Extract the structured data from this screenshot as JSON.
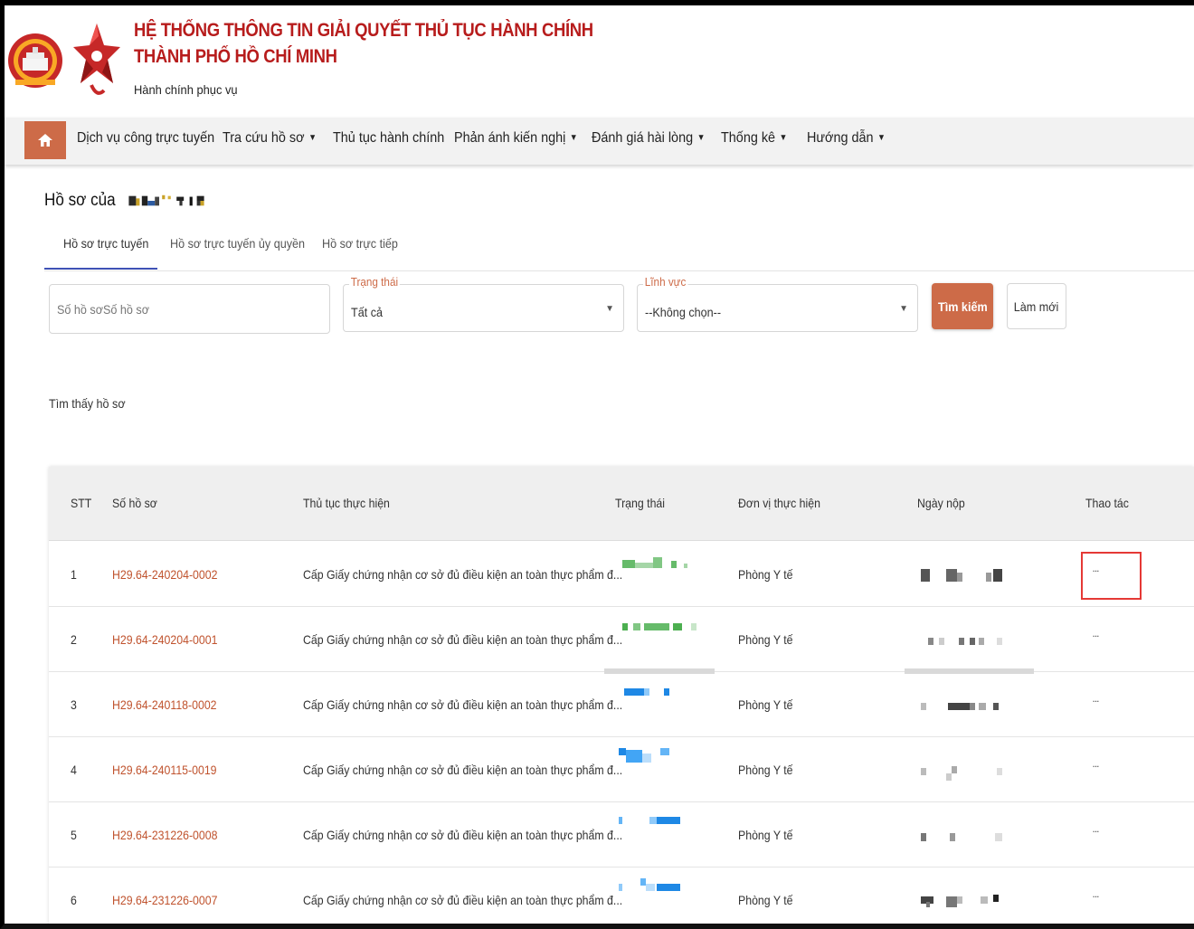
{
  "header": {
    "title_line1": "HỆ THỐNG THÔNG TIN GIẢI QUYẾT THỦ TỤC HÀNH CHÍNH",
    "title_line2": "THÀNH PHỐ HỒ CHÍ MINH",
    "subtitle": "Hành chính phục vụ"
  },
  "nav": {
    "items": [
      {
        "label": "Dịch vụ công trực tuyến",
        "dropdown": false
      },
      {
        "label": "Tra cứu hồ sơ",
        "dropdown": true
      },
      {
        "label": "Thủ tục hành chính",
        "dropdown": false
      },
      {
        "label": "Phản ánh kiến nghị",
        "dropdown": true
      },
      {
        "label": "Đánh giá hài lòng",
        "dropdown": true
      },
      {
        "label": "Thống kê",
        "dropdown": true
      },
      {
        "label": "Hướng dẫn",
        "dropdown": true
      }
    ],
    "caret": "▼"
  },
  "page": {
    "title_prefix": "Hồ sơ của"
  },
  "tabs": [
    {
      "label": "Hồ sơ trực tuyến",
      "active": true
    },
    {
      "label": "Hồ sơ trực tuyến ủy quyền",
      "active": false
    },
    {
      "label": "Hồ sơ trực tiếp",
      "active": false
    }
  ],
  "filters": {
    "so_ho_so_placeholder": "Số hồ sơSố hồ sơ",
    "trang_thai_label": "Trạng thái",
    "trang_thai_value": "Tất cả",
    "linh_vuc_label": "Lĩnh vực",
    "linh_vuc_value": "--Không chọn--",
    "search_button": "Tìm kiếm",
    "reset_button": "Làm mới"
  },
  "result": {
    "found_text": "Tìm thấy hồ sơ"
  },
  "table": {
    "headers": [
      "STT",
      "Số hồ sơ",
      "Thủ tục thực hiện",
      "Trạng thái",
      "Đơn vị thực hiện",
      "Ngày nộp",
      "Thao tác"
    ],
    "rows": [
      {
        "stt": "1",
        "code": "H29.64-240204-0002",
        "procedure": "Cấp Giấy chứng nhận cơ sở đủ điều kiện an toàn thực phẩm đ...",
        "unit": "Phòng Y tế",
        "action": "...",
        "status_color": "#4caf50"
      },
      {
        "stt": "2",
        "code": "H29.64-240204-0001",
        "procedure": "Cấp Giấy chứng nhận cơ sở đủ điều kiện an toàn thực phẩm đ...",
        "unit": "Phòng Y tế",
        "action": "...",
        "status_color": "#4caf50"
      },
      {
        "stt": "3",
        "code": "H29.64-240118-0002",
        "procedure": "Cấp Giấy chứng nhận cơ sở đủ điều kiện an toàn thực phẩm đ...",
        "unit": "Phòng Y tế",
        "action": "...",
        "status_color": "#2196f3"
      },
      {
        "stt": "4",
        "code": "H29.64-240115-0019",
        "procedure": "Cấp Giấy chứng nhận cơ sở đủ điều kiện an toàn thực phẩm đ...",
        "unit": "Phòng Y tế",
        "action": "...",
        "status_color": "#2196f3"
      },
      {
        "stt": "5",
        "code": "H29.64-231226-0008",
        "procedure": "Cấp Giấy chứng nhận cơ sở đủ điều kiện an toàn thực phẩm đ...",
        "unit": "Phòng Y tế",
        "action": "...",
        "status_color": "#2196f3"
      },
      {
        "stt": "6",
        "code": "H29.64-231226-0007",
        "procedure": "Cấp Giấy chứng nhận cơ sở đủ điều kiện an toàn thực phẩm đ...",
        "unit": "Phòng Y tế",
        "action": "...",
        "status_color": "#2196f3"
      }
    ]
  },
  "colors": {
    "brand_red": "#b71c1c",
    "accent": "#cd6b48",
    "tab_active": "#3f51b5",
    "highlight_box": "#e53935"
  }
}
